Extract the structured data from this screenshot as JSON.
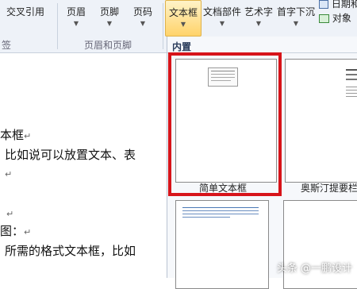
{
  "ribbon": {
    "left_group_tail": "签",
    "cross_ref": "交叉引用",
    "header_btn": "页眉",
    "footer_btn": "页脚",
    "pagenum_btn": "页码",
    "header_footer_group": "页眉和页脚",
    "textbox_btn": "文本框",
    "docparts_btn": "文档部件",
    "wordart_btn": "艺术字",
    "dropcap_btn": "首字下沉",
    "date_btn": "日期和",
    "object_btn": "对象"
  },
  "document": {
    "lines": [
      "本框",
      "比如说可以放置文本、表",
      "",
      "",
      "图：",
      "所需的格式文本框，比如"
    ]
  },
  "gallery": {
    "section_label": "内置",
    "tiles": [
      {
        "label": "简单文本框"
      },
      {
        "label": "奥斯汀提要栏"
      }
    ]
  },
  "watermark": "头条 @一鹏设计"
}
